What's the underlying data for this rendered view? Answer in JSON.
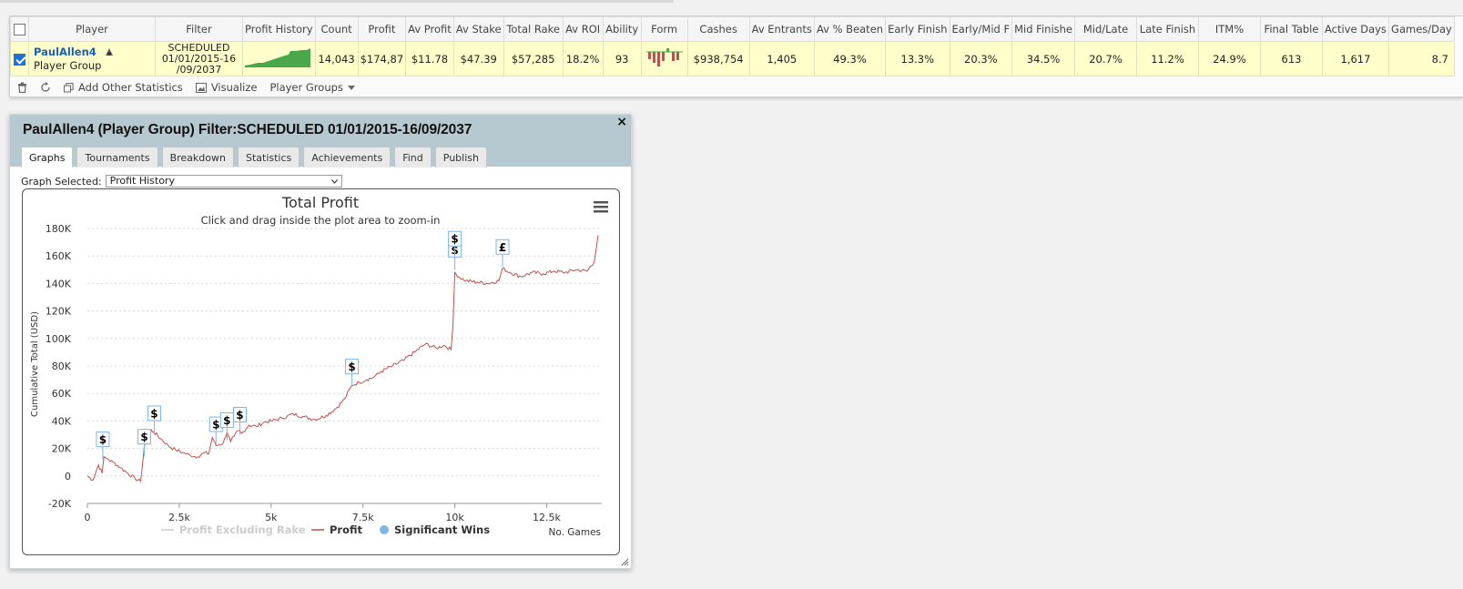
{
  "table": {
    "columns": [
      "",
      "Player",
      "Filter",
      "Profit History",
      "Count",
      "Profit",
      "Av Profit",
      "Av Stake",
      "Total Rake",
      "Av ROI",
      "Ability",
      "Form",
      "Cashes",
      "Av Entrants",
      "Av % Beaten",
      "Early Finish",
      "Early/Mid F",
      "Mid Finishe",
      "Mid/Late",
      "Late Finish",
      "ITM%",
      "Final Table",
      "Active Days",
      "Games/Day"
    ],
    "row": {
      "player_name": "PaulAllen4",
      "player_type": "Player Group",
      "filter": "SCHEDULED 01/01/2015-16 /09/2037",
      "count": "14,043",
      "profit": "$174,87",
      "av_profit": "$11.78",
      "av_stake": "$47.39",
      "total_rake": "$57,285",
      "av_roi": "18.2%",
      "ability": "93",
      "cashes": "$938,754",
      "av_entrants": "1,405",
      "av_beaten": "49.3%",
      "early_finish": "13.3%",
      "early_mid": "20.3%",
      "mid_finish": "34.5%",
      "mid_late": "20.7%",
      "late_finish": "11.2%",
      "itm": "24.9%",
      "final_table": "613",
      "active_days": "1,617",
      "games_day": "8.7"
    }
  },
  "toolbar": {
    "add_stats": "Add Other Statistics",
    "visualize": "Visualize",
    "player_groups": "Player Groups"
  },
  "dialog": {
    "title": "PaulAllen4 (Player Group) Filter:SCHEDULED 01/01/2015-16/09/2037",
    "tabs": [
      "Graphs",
      "Tournaments",
      "Breakdown",
      "Statistics",
      "Achievements",
      "Find",
      "Publish"
    ],
    "active_tab": "Graphs",
    "graph_selected_label": "Graph Selected:",
    "graph_selected_value": "Profit History"
  },
  "colors": {
    "profit_line": "#c0504d",
    "header_bar": "#b6c8d0",
    "row_highlight": "#ffffcc",
    "link": "#1b5fb4",
    "sparkline": "#49a84a",
    "win_marker": "#7cb5ec"
  },
  "chart_data": {
    "type": "line",
    "title": "Total Profit",
    "subtitle": "Click and drag inside the plot area to zoom-in",
    "xlabel": "No. Games",
    "ylabel": "Cumulative Total (USD)",
    "xlim": [
      0,
      14000
    ],
    "ylim": [
      -20000,
      180000
    ],
    "x_ticks": [
      "0",
      "2.5k",
      "5k",
      "7.5k",
      "10k",
      "12.5k"
    ],
    "y_ticks": [
      "-20K",
      "0",
      "20K",
      "40K",
      "60K",
      "80K",
      "100K",
      "120K",
      "140K",
      "160K",
      "180K"
    ],
    "legend": [
      "Profit Excluding Rake",
      "Profit",
      "Significant Wins"
    ],
    "legend_position": "bottom",
    "series": [
      {
        "name": "Profit",
        "x": [
          0,
          150,
          300,
          400,
          450,
          500,
          700,
          900,
          1100,
          1300,
          1450,
          1500,
          1550,
          1700,
          1800,
          2000,
          2200,
          2400,
          2600,
          2800,
          3000,
          3200,
          3300,
          3400,
          3500,
          3700,
          3800,
          3900,
          4000,
          4100,
          4200,
          4400,
          4600,
          4800,
          5000,
          5300,
          5600,
          5900,
          6200,
          6500,
          6800,
          7000,
          7200,
          7400,
          7600,
          7800,
          8000,
          8300,
          8600,
          8900,
          9200,
          9500,
          9700,
          9900,
          9950,
          10000,
          10100,
          10300,
          10600,
          10900,
          11200,
          11300,
          11500,
          11800,
          12100,
          12400,
          12700,
          13000,
          13300,
          13600,
          13800,
          13900
        ],
        "values": [
          0,
          -3000,
          8000,
          2000,
          14000,
          13000,
          10000,
          6000,
          2000,
          -2000,
          -4000,
          8000,
          22000,
          34000,
          32000,
          27000,
          22000,
          19000,
          17000,
          15000,
          14000,
          17000,
          16000,
          28000,
          22000,
          24000,
          32000,
          25000,
          29000,
          33000,
          31000,
          37000,
          36000,
          39000,
          40000,
          42000,
          45000,
          43000,
          41000,
          44000,
          50000,
          56000,
          66000,
          68000,
          70000,
          72000,
          76000,
          80000,
          84000,
          90000,
          96000,
          93000,
          95000,
          92000,
          110000,
          148000,
          145000,
          142000,
          141000,
          140000,
          142000,
          151000,
          148000,
          145000,
          148000,
          147000,
          149000,
          148000,
          150000,
          149000,
          156000,
          175000
        ]
      }
    ],
    "significant_wins": [
      {
        "x": 420,
        "y": 12000,
        "label": "$"
      },
      {
        "x": 1550,
        "y": 14000,
        "label": "$"
      },
      {
        "x": 1820,
        "y": 31000,
        "label": "$"
      },
      {
        "x": 3500,
        "y": 23000,
        "label": "$"
      },
      {
        "x": 3800,
        "y": 26000,
        "label": "$"
      },
      {
        "x": 4150,
        "y": 30000,
        "label": "$"
      },
      {
        "x": 7200,
        "y": 65000,
        "label": "$"
      },
      {
        "x": 10000,
        "y": 150000,
        "label": "$"
      },
      {
        "x": 10000,
        "y": 158000,
        "label": "$"
      },
      {
        "x": 11300,
        "y": 152000,
        "label": "£"
      }
    ]
  }
}
